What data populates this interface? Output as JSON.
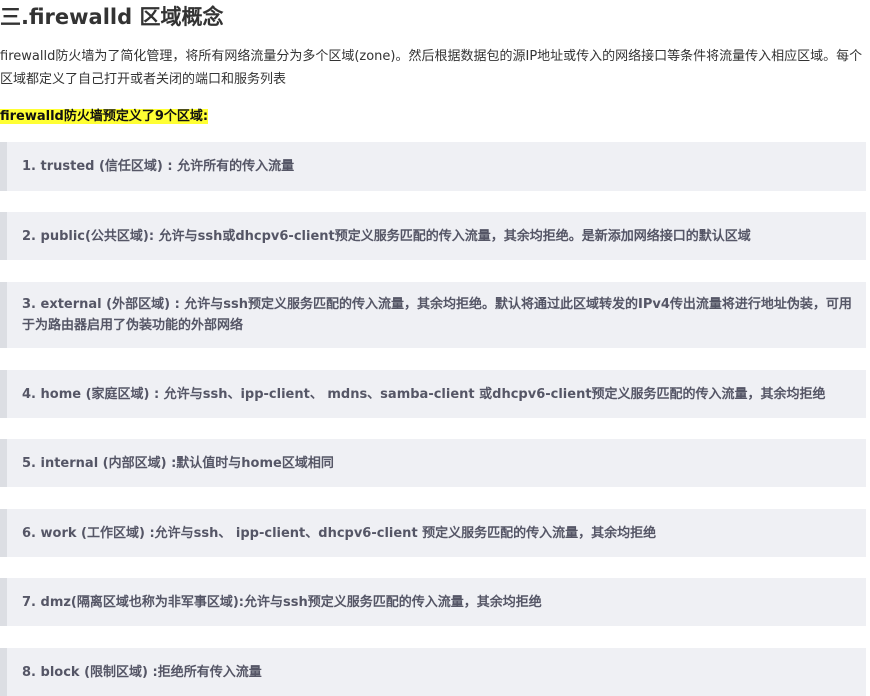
{
  "section": {
    "heading": "三.firewalld 区域概念",
    "intro": "firewalld防火墙为了简化管理，将所有网络流量分为多个区域(zone)。然后根据数据包的源IP地址或传入的网络接口等条件将流量传入相应区域。每个区域都定义了自己打开或者关闭的端口和服务列表",
    "highlight": "firewalld防火墙预定义了9个区域:",
    "zones": [
      "1. trusted (信任区域) : 允许所有的传入流量",
      "2. public(公共区域): 允许与ssh或dhcpv6-client预定义服务匹配的传入流量，其余均拒绝。是新添加网络接口的默认区域",
      "3. external (外部区域) : 允许与ssh预定义服务匹配的传入流量，其余均拒绝。默认将通过此区域转发的IPv4传出流量将进行地址伪装，可用于为路由器启用了伪装功能的外部网络",
      "4. home (家庭区域) : 允许与ssh、ipp-client、 mdns、samba-client 或dhcpv6-client预定义服务匹配的传入流量，其余均拒绝",
      "5. internal (内部区域) :默认值时与home区域相同",
      "6. work (工作区域) :允许与ssh、 ipp-client、dhcpv6-client 预定义服务匹配的传入流量，其余均拒绝",
      "7. dmz(隔离区域也称为非军事区域):允许与ssh预定义服务匹配的传入流量，其余均拒绝",
      "8. block (限制区域) :拒绝所有传入流量"
    ]
  }
}
